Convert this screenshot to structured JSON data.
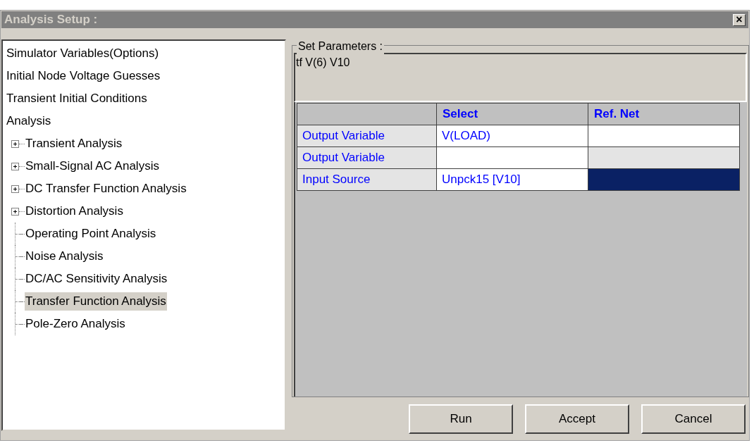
{
  "window": {
    "title": "Analysis Setup :",
    "close": "×"
  },
  "tree": [
    {
      "label": "Simulator Variables(Options)",
      "selected": false
    },
    {
      "label": "Initial Node Voltage Guesses",
      "selected": false
    },
    {
      "label": "Transient Initial Conditions",
      "selected": false
    },
    {
      "label": "Analysis",
      "selected": false,
      "children": [
        {
          "label": "Transient Analysis",
          "selected": false,
          "expandable": true
        },
        {
          "label": "Small-Signal AC Analysis",
          "selected": false,
          "expandable": true
        },
        {
          "label": "DC Transfer Function Analysis",
          "selected": false,
          "expandable": true
        },
        {
          "label": "Distortion Analysis",
          "selected": false,
          "expandable": true
        },
        {
          "label": "Operating Point Analysis",
          "selected": false,
          "expandable": false
        },
        {
          "label": "Noise Analysis",
          "selected": false,
          "expandable": false
        },
        {
          "label": "DC/AC Sensitivity Analysis",
          "selected": false,
          "expandable": false
        },
        {
          "label": "Transfer Function Analysis",
          "selected": true,
          "expandable": false
        },
        {
          "label": "Pole-Zero Analysis",
          "selected": false,
          "expandable": false
        }
      ]
    }
  ],
  "parameters": {
    "label": "Set Parameters :",
    "command": "tf V(6) V10"
  },
  "table": {
    "columns": [
      "Select",
      "Ref. Net"
    ],
    "rows": [
      {
        "label": "Output Variable",
        "select": "V(LOAD)",
        "ref_net_disabled": false,
        "ref_net_selected": false
      },
      {
        "label": "Output Variable",
        "ref_net_disabled": true,
        "ref_net_selected": false
      },
      {
        "label": "Input Source",
        "select": "Unpck15 [V10]",
        "ref_net_disabled": false,
        "ref_net_selected": true
      }
    ]
  },
  "buttons": [
    "Run",
    "Accept",
    "Cancel"
  ]
}
